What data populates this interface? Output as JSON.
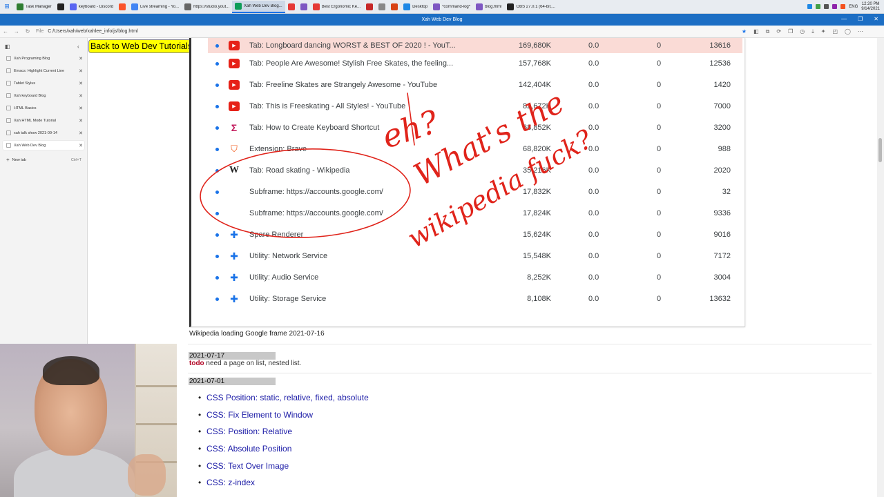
{
  "taskbar": {
    "apps": [
      {
        "label": "Task Manager",
        "color": "#2e7d32"
      },
      {
        "label": "",
        "color": "#222222"
      },
      {
        "label": "keyboard - Discord",
        "color": "#5865f2"
      },
      {
        "label": "",
        "color": "#fb542b"
      },
      {
        "label": "Live streaming - Yo...",
        "color": "#4285f4"
      },
      {
        "label": "https://studio.yout...",
        "color": "#666666"
      },
      {
        "label": "Xah Web Dev Blog...",
        "color": "#0f9d58"
      },
      {
        "label": "",
        "color": "#e53935"
      },
      {
        "label": "",
        "color": "#7e57c2"
      },
      {
        "label": "Best Ergonomic Ke...",
        "color": "#e53935"
      },
      {
        "label": "",
        "color": "#c62828"
      },
      {
        "label": "",
        "color": "#888888"
      },
      {
        "label": "",
        "color": "#d84315"
      },
      {
        "label": "Desktop",
        "color": "#1e88e5"
      },
      {
        "label": "*command-log*",
        "color": "#7e57c2"
      },
      {
        "label": "blog.html",
        "color": "#7e57c2"
      },
      {
        "label": "OBS 27.0.1 (64-bit,...",
        "color": "#212121"
      }
    ],
    "tray_lang": "ENG",
    "clock_time": "12:20 PM",
    "clock_date": "9/14/2021"
  },
  "browser": {
    "window_title": "Xah Web Dev Blog",
    "url_label": "File",
    "url": "C:/Users/xah/web/xahlee_info/js/blog.html"
  },
  "sidebar": {
    "tabs": [
      {
        "title": "Xah Programing Blog",
        "active": false
      },
      {
        "title": "Emacs: Highlight Current Line",
        "active": false
      },
      {
        "title": "Tablet Stylus",
        "active": false
      },
      {
        "title": "Xah keyboard Blog",
        "active": false
      },
      {
        "title": "HTML Basics",
        "active": false
      },
      {
        "title": "Xah HTML Mode Tutorial",
        "active": false
      },
      {
        "title": "xah talk show 2021-09-14",
        "active": false
      },
      {
        "title": "Xah Web Dev Blog",
        "active": true
      }
    ],
    "new_tab_label": "New tab",
    "new_tab_shortcut": "Ctrl+T"
  },
  "page": {
    "back_button": "Back to Web Dev Tutorials",
    "task_manager_rows": [
      {
        "icon": "youtube-icon",
        "name": "Tab: Longboard dancing WORST & BEST OF 2020 ! - YouT...",
        "memory": "169,680K",
        "cpu": "0.0",
        "network": "0",
        "pid": "13616",
        "highlight": true
      },
      {
        "icon": "youtube-icon",
        "name": "Tab: People Are Awesome! Stylish Free Skates, the feeling...",
        "memory": "157,768K",
        "cpu": "0.0",
        "network": "0",
        "pid": "12536",
        "highlight": false
      },
      {
        "icon": "youtube-icon",
        "name": "Tab: Freeline Skates are Strangely Awesome - YouTube",
        "memory": "142,404K",
        "cpu": "0.0",
        "network": "0",
        "pid": "1420",
        "highlight": false
      },
      {
        "icon": "youtube-icon",
        "name": "Tab: This is Freeskating - All Styles! - YouTube",
        "memory": "82,672K",
        "cpu": "0.0",
        "network": "0",
        "pid": "7000",
        "highlight": false
      },
      {
        "icon": "sigma-icon",
        "name": "Tab: How to Create Keyboard Shortcut",
        "memory": "68,852K",
        "cpu": "0.0",
        "network": "0",
        "pid": "3200",
        "highlight": false
      },
      {
        "icon": "brave-lion-icon",
        "name": "Extension: Brave",
        "memory": "68,820K",
        "cpu": "0.0",
        "network": "0",
        "pid": "988",
        "highlight": false
      },
      {
        "icon": "wikipedia-icon",
        "name": "Tab: Road skating - Wikipedia",
        "memory": "35,216K",
        "cpu": "0.0",
        "network": "0",
        "pid": "2020",
        "highlight": false
      },
      {
        "icon": "",
        "name": "Subframe: https://accounts.google.com/",
        "memory": "17,832K",
        "cpu": "0.0",
        "network": "0",
        "pid": "32",
        "highlight": false
      },
      {
        "icon": "",
        "name": "Subframe: https://accounts.google.com/",
        "memory": "17,824K",
        "cpu": "0.0",
        "network": "0",
        "pid": "9336",
        "highlight": false
      },
      {
        "icon": "puzzle-icon",
        "name": "Spare Renderer",
        "memory": "15,624K",
        "cpu": "0.0",
        "network": "0",
        "pid": "9016",
        "highlight": false
      },
      {
        "icon": "puzzle-icon",
        "name": "Utility: Network Service",
        "memory": "15,548K",
        "cpu": "0.0",
        "network": "0",
        "pid": "7172",
        "highlight": false
      },
      {
        "icon": "puzzle-icon",
        "name": "Utility: Audio Service",
        "memory": "8,252K",
        "cpu": "0.0",
        "network": "0",
        "pid": "3004",
        "highlight": false
      },
      {
        "icon": "puzzle-icon",
        "name": "Utility: Storage Service",
        "memory": "8,108K",
        "cpu": "0.0",
        "network": "0",
        "pid": "13632",
        "highlight": false
      }
    ],
    "caption": "Wikipedia loading Google frame 2021-07-16",
    "entry1": {
      "date": "2021-07-17",
      "todo_tag": "todo",
      "todo_text": " need a page on list, nested list."
    },
    "entry2": {
      "date": "2021-07-01",
      "links": [
        "CSS Position: static, relative, fixed, absolute",
        "CSS: Fix Element to Window",
        "CSS: Position: Relative",
        "CSS: Absolute Position",
        "CSS: Text Over Image",
        "CSS: z-index"
      ]
    }
  },
  "handwriting": {
    "ink_color": "#e0241b",
    "line1": "eh?",
    "line2": "What's the",
    "line3": "wikipedia fuck?"
  }
}
